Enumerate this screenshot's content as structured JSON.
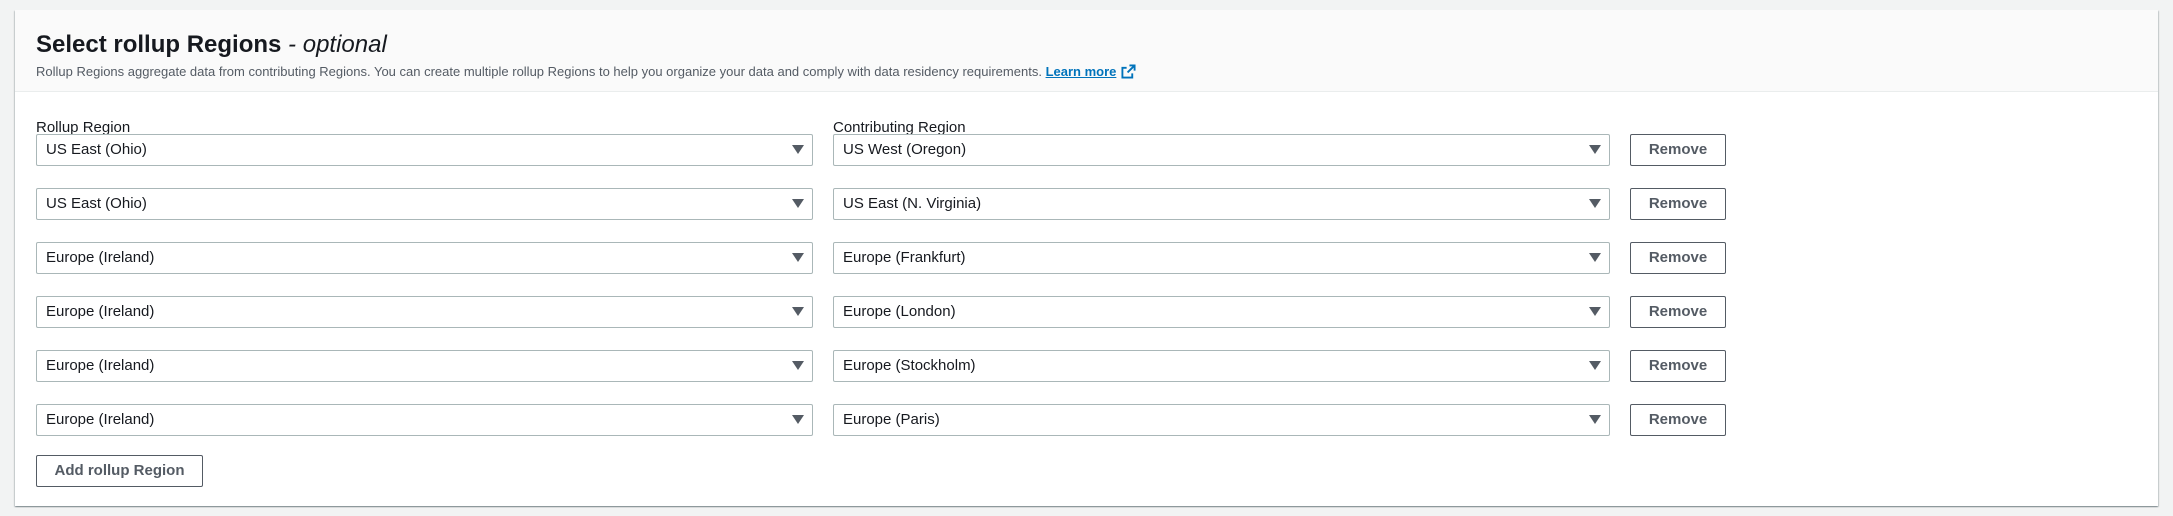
{
  "header": {
    "title": "Select rollup Regions",
    "title_suffix": " - optional",
    "description": "Rollup Regions aggregate data from contributing Regions. You can create multiple rollup Regions to help you organize your data and comply with data residency requirements.",
    "learn_more": "Learn more",
    "learn_more_icon": "external-link-icon"
  },
  "columns": {
    "rollup_label": "Rollup Region",
    "contributing_label": "Contributing Region"
  },
  "rows": [
    {
      "rollup": "US East (Ohio)",
      "contributing": "US West (Oregon)",
      "remove": "Remove"
    },
    {
      "rollup": "US East (Ohio)",
      "contributing": "US East (N. Virginia)",
      "remove": "Remove"
    },
    {
      "rollup": "Europe (Ireland)",
      "contributing": "Europe (Frankfurt)",
      "remove": "Remove"
    },
    {
      "rollup": "Europe (Ireland)",
      "contributing": "Europe (London)",
      "remove": "Remove"
    },
    {
      "rollup": "Europe (Ireland)",
      "contributing": "Europe (Stockholm)",
      "remove": "Remove"
    },
    {
      "rollup": "Europe (Ireland)",
      "contributing": "Europe (Paris)",
      "remove": "Remove"
    }
  ],
  "add_button": "Add rollup Region",
  "colors": {
    "link": "#0073bb",
    "text": "#16191f",
    "secondary_text": "#545b64",
    "border": "#aab7b8"
  }
}
